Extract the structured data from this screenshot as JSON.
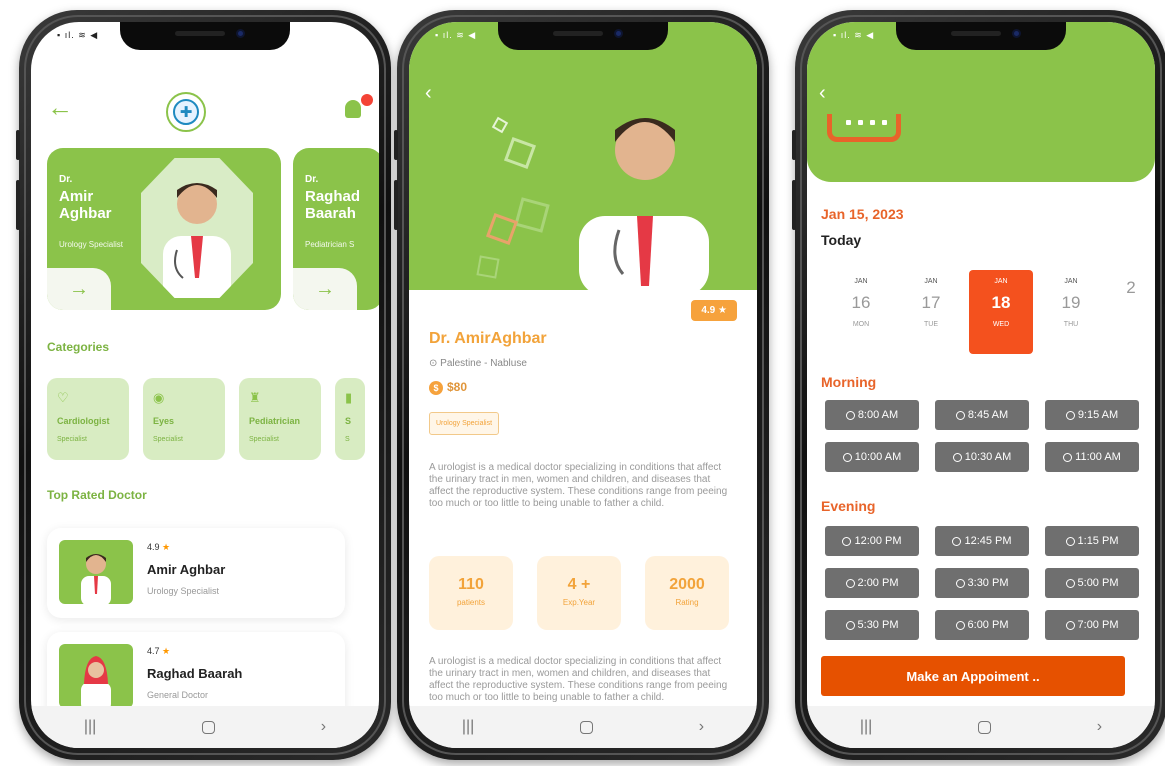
{
  "screen1": {
    "featured": [
      {
        "prefix": "Dr.",
        "name": "Amir Aghbar",
        "specialty": "Urology Specialist"
      },
      {
        "prefix": "Dr.",
        "name": "Raghad Baarah",
        "specialty": "Pediatrician S"
      }
    ],
    "arrow": "→",
    "categories_title": "Categories",
    "categories": [
      {
        "icon": "heart-pulse-icon",
        "glyph": "♡",
        "name": "Cardiologist",
        "sub": "Specialist"
      },
      {
        "icon": "eye-icon",
        "glyph": "◉",
        "name": "Eyes",
        "sub": "Specialist"
      },
      {
        "icon": "stroller-icon",
        "glyph": "♜",
        "name": "Pediatrician",
        "sub": "Specialist"
      },
      {
        "icon": "category-icon",
        "glyph": "▮",
        "name": "S",
        "sub": "S"
      }
    ],
    "top_rated_title": "Top Rated Doctor",
    "top_rated": [
      {
        "rating": "4.9",
        "name": "Amir Aghbar",
        "specialty": "Urology Specialist"
      },
      {
        "rating": "4.7",
        "name": "Raghad Baarah",
        "specialty": "General Doctor"
      }
    ]
  },
  "screen2": {
    "rating": "4.9 ★",
    "name": "Dr. AmirAghbar",
    "location": "Palestine - Nabluse",
    "price": "$80",
    "tag": "Urology Specialist",
    "description": "A urologist is a medical doctor specializing in conditions that affect the urinary tract in men, women and children, and diseases that affect the reproductive system. These conditions range from peeing too much or too little to being unable to father a child.",
    "stats": [
      {
        "value": "110",
        "label": "patients"
      },
      {
        "value": "4 +",
        "label": "Exp.Year"
      },
      {
        "value": "2000",
        "label": "Rating"
      }
    ]
  },
  "screen3": {
    "date": "Jan 15, 2023",
    "today": "Today",
    "days": [
      {
        "month": "JAN",
        "day": "16",
        "weekday": "MON"
      },
      {
        "month": "JAN",
        "day": "17",
        "weekday": "TUE"
      },
      {
        "month": "JAN",
        "day": "18",
        "weekday": "WED"
      },
      {
        "month": "JAN",
        "day": "19",
        "weekday": "THU"
      },
      {
        "month": "",
        "day": "2",
        "weekday": ""
      }
    ],
    "morning_label": "Morning",
    "morning_slots": [
      "8:00 AM",
      "8:45 AM",
      "9:15 AM",
      "10:00 AM",
      "10:30 AM",
      "11:00 AM"
    ],
    "evening_label": "Evening",
    "evening_slots": [
      "12:00 PM",
      "12:45 PM",
      "1:15 PM",
      "2:00 PM",
      "3:30 PM",
      "5:00 PM",
      "5:30 PM",
      "6:00 PM",
      "7:00 PM"
    ],
    "cta": "Make an Appoiment .."
  },
  "nav": {
    "recent": "|||",
    "back": "›"
  },
  "colors": {
    "green": "#8bc34a",
    "orange": "#f2a33a",
    "cta": "#e65100",
    "slot": "#6f6f6f"
  }
}
